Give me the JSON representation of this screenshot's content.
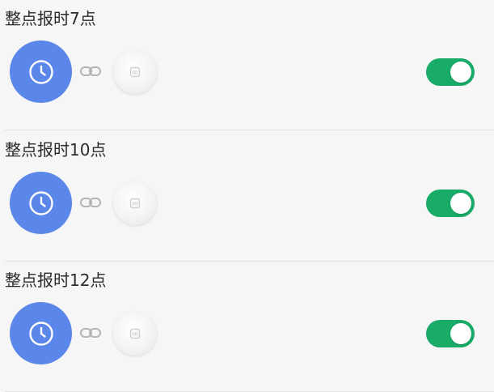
{
  "colors": {
    "trigger_circle": "#5b86ea",
    "toggle_on": "#19ab68",
    "background": "#f6f6f6"
  },
  "automations": [
    {
      "title": "整点报时7点",
      "trigger_icon": "clock-icon",
      "device_icon": "smart-speaker-icon",
      "enabled": true
    },
    {
      "title": "整点报时10点",
      "trigger_icon": "clock-icon",
      "device_icon": "smart-speaker-icon",
      "enabled": true
    },
    {
      "title": "整点报时12点",
      "trigger_icon": "clock-icon",
      "device_icon": "smart-speaker-icon",
      "enabled": true
    }
  ]
}
